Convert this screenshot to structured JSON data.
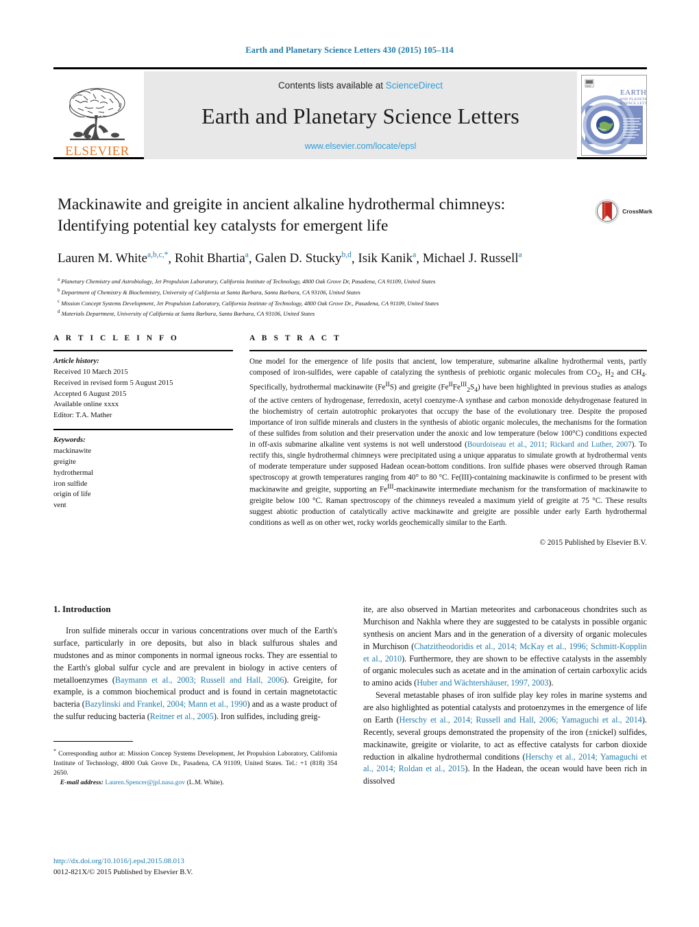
{
  "running_head": "Earth and Planetary Science Letters 430 (2015) 105–114",
  "masthead": {
    "publisher_name": "ELSEVIER",
    "contents_prefix": "Contents lists available at ",
    "contents_link": "ScienceDirect",
    "journal_title": "Earth and Planetary Science Letters",
    "journal_url": "www.elsevier.com/locate/epsl",
    "cover_title_line1": "EARTH",
    "cover_title_line2": "AND PLANETARY",
    "cover_title_line3": "SCIENCE LETTERS"
  },
  "crossmark": {
    "label": "CrossMark"
  },
  "article": {
    "title_line1": "Mackinawite and greigite in ancient alkaline hydrothermal chimneys:",
    "title_line2": "Identifying potential key catalysts for emergent life",
    "authors": [
      {
        "name": "Lauren M. White",
        "sup": "a,b,c,",
        "star": "*"
      },
      {
        "name": "Rohit Bhartia",
        "sup": "a",
        "star": ""
      },
      {
        "name": "Galen D. Stucky",
        "sup": "b,d",
        "star": ""
      },
      {
        "name": "Isik Kanik",
        "sup": "a",
        "star": ""
      },
      {
        "name": "Michael J. Russell",
        "sup": "a",
        "star": ""
      }
    ],
    "affiliations": [
      {
        "mark": "a",
        "text": "Planetary Chemistry and Astrobiology, Jet Propulsion Laboratory, California Institute of Technology, 4800 Oak Grove Dr, Pasadena, CA 91109, United States"
      },
      {
        "mark": "b",
        "text": "Department of Chemistry & Biochemistry, University of California at Santa Barbara, Santa Barbara, CA 93106, United States"
      },
      {
        "mark": "c",
        "text": "Mission Concept Systems Development, Jet Propulsion Laboratory, California Institute of Technology, 4800 Oak Grove Dr., Pasadena, CA 91109, United States"
      },
      {
        "mark": "d",
        "text": "Materials Department, University of California at Santa Barbara, Santa Barbara, CA 93106, United States"
      }
    ]
  },
  "article_info": {
    "heading": "A R T I C L E   I N F O",
    "history_label": "Article history:",
    "history": [
      "Received 10 March 2015",
      "Received in revised form 5 August 2015",
      "Accepted 6 August 2015",
      "Available online xxxx",
      "Editor: T.A. Mather"
    ],
    "keywords_label": "Keywords:",
    "keywords": [
      "mackinawite",
      "greigite",
      "hydrothermal",
      "iron sulfide",
      "origin of life",
      "vent"
    ]
  },
  "abstract": {
    "heading": "A B S T R A C T",
    "copyright": "© 2015 Published by Elsevier B.V.",
    "references_inline": [
      "Bourdoiseau et al., 2011; Rickard and Luther, 2007"
    ]
  },
  "introduction": {
    "heading": "1. Introduction",
    "references_left": [
      "Baymann et al., 2003; Russell and Hall, 2006",
      "Bazylinski and Frankel, 2004; Mann et al., 1990",
      "Reitner et al., 2005"
    ],
    "references_right": [
      "Chatzitheodoridis et al., 2014; McKay et al., 1996; Schmitt-Kopplin et al., 2010",
      "Huber and Wächtershäuser, 1997, 2003",
      "Herschy et al., 2014; Russell and Hall, 2006; Yamaguchi et al., 2014",
      "Herschy et al., 2014; Yamaguchi et al., 2014; Roldan et al., 2015"
    ]
  },
  "footnote": {
    "marker": "*",
    "text": "Corresponding author at: Mission Concep Systems Development, Jet Propulsion Laboratory, California Institute of Technology, 4800 Oak Grove Dr., Pasadena, CA 91109, United States. Tel.: +1 (818) 354 2650.",
    "email_label": "E-mail address:",
    "email": "Lauren.Spencer@jpl.nasa.gov",
    "email_owner": "(L.M. White)."
  },
  "footer": {
    "doi": "http://dx.doi.org/10.1016/j.epsl.2015.08.013",
    "issn_line": "0012-821X/© 2015 Published by Elsevier B.V."
  },
  "colors": {
    "link": "#1f7aa8",
    "sciencedirect": "#2e9bd6",
    "elsevier_orange": "#E87722",
    "masthead_gray": "#e8e8e8"
  }
}
